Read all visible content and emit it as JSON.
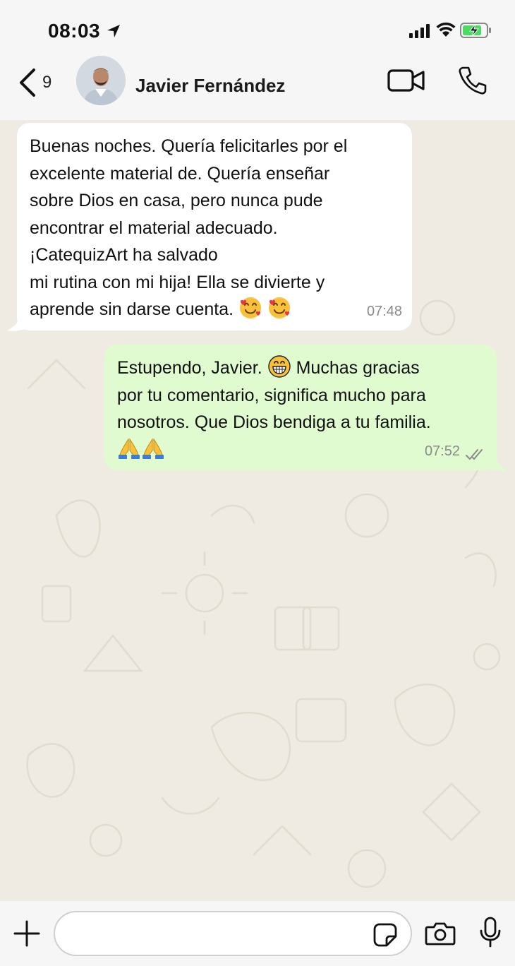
{
  "status_bar": {
    "time": "08:03"
  },
  "header": {
    "back_count": "9",
    "contact_name": "Javier Fernández"
  },
  "messages": [
    {
      "direction": "incoming",
      "lines": [
        "Buenas noches. Quería felicitarles por el",
        "excelente material de. Quería enseñar",
        "sobre Dios en casa, pero nunca pude",
        "encontrar el material adecuado.",
        "¡CatequizArt ha salvado",
        "mi rutina con mi hija! Ella se divierte y",
        "aprende sin darse cuenta."
      ],
      "emoji": [
        "smiling-face-with-hearts",
        "smiling-face-with-hearts"
      ],
      "time": "07:48"
    },
    {
      "direction": "outgoing",
      "lines": [
        "Estupendo, Javier.",
        "Muchas gracias",
        "por tu comentario, significa mucho para",
        "nosotros. Que Dios bendiga a tu familia."
      ],
      "emoji": [
        "grinning-face",
        "folded-hands",
        "folded-hands"
      ],
      "time": "07:52",
      "status": "read"
    }
  ],
  "input": {
    "placeholder": ""
  },
  "colors": {
    "incoming_bubble": "#ffffff",
    "outgoing_bubble": "#e1fbd0",
    "chat_background": "#efeae2",
    "read_receipt": "#8a8a8a"
  }
}
